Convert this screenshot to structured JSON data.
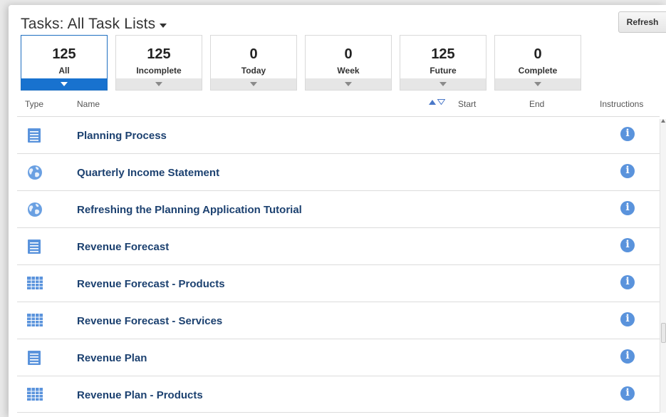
{
  "header": {
    "title": "Tasks: All Task Lists",
    "refresh_label": "Refresh"
  },
  "filters": [
    {
      "count": "125",
      "label": "All",
      "active": true
    },
    {
      "count": "125",
      "label": "Incomplete",
      "active": false
    },
    {
      "count": "0",
      "label": "Today",
      "active": false
    },
    {
      "count": "0",
      "label": "Week",
      "active": false
    },
    {
      "count": "125",
      "label": "Future",
      "active": false
    },
    {
      "count": "0",
      "label": "Complete",
      "active": false
    }
  ],
  "columns": {
    "type": "Type",
    "name": "Name",
    "start": "Start",
    "end": "End",
    "instructions": "Instructions"
  },
  "tasks": [
    {
      "icon": "form-icon",
      "name": "Planning Process"
    },
    {
      "icon": "globe-icon",
      "name": "Quarterly Income Statement"
    },
    {
      "icon": "globe-icon",
      "name": "Refreshing the Planning Application Tutorial"
    },
    {
      "icon": "form-icon",
      "name": "Revenue Forecast"
    },
    {
      "icon": "grid-icon",
      "name": "Revenue Forecast - Products"
    },
    {
      "icon": "grid-icon",
      "name": "Revenue Forecast - Services"
    },
    {
      "icon": "form-icon",
      "name": "Revenue Plan"
    },
    {
      "icon": "grid-icon",
      "name": "Revenue Plan - Products"
    }
  ],
  "colors": {
    "accent": "#1872cf",
    "link": "#1c4170",
    "info": "#5a93dc"
  }
}
